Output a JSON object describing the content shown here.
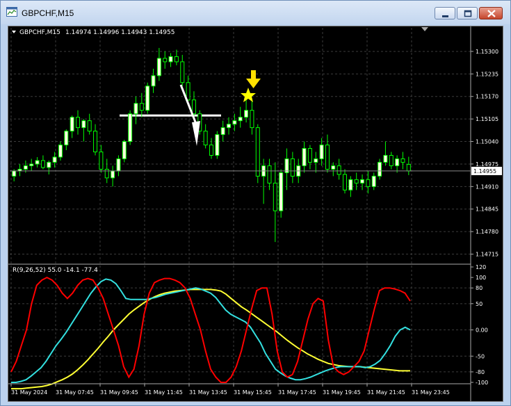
{
  "window": {
    "title": "GBPCHF,M15"
  },
  "chart_header": {
    "symbol": "GBPCHF,M15",
    "ohlc": "1.14974 1.14996 1.14943 1.14955"
  },
  "price_axis": {
    "labels": [
      "1.15300",
      "1.15235",
      "1.15170",
      "1.15105",
      "1.15040",
      "1.14975",
      "1.14910",
      "1.14845",
      "1.14780",
      "1.14715"
    ],
    "current_price": "1.14955"
  },
  "indicator": {
    "label": "R(9,26,52) 55.0 -14.1 -77.4",
    "axis_labels": [
      "120",
      "100",
      "80",
      "50",
      "0.00",
      "-50",
      "-80",
      "-100"
    ]
  },
  "time_axis": {
    "labels": [
      "31 May 2024",
      "31 May 07:45",
      "31 May 09:45",
      "31 May 11:45",
      "31 May 13:45",
      "31 May 15:45",
      "31 May 17:45",
      "31 May 19:45",
      "31 May 21:45",
      "31 May 23:45"
    ]
  },
  "colors": {
    "bull": "#ffffe0",
    "bear": "#00ff00",
    "red_line": "#ff0000",
    "cyan_line": "#33e0e0",
    "yellow_line": "#ffff33",
    "annotation": "#ffff00"
  },
  "chart_data": {
    "type": "line",
    "candles": [
      [
        1.1494,
        1.1496,
        1.14925,
        1.14955
      ],
      [
        1.14955,
        1.14975,
        1.1494,
        1.1496
      ],
      [
        1.1496,
        1.14985,
        1.1495,
        1.1497
      ],
      [
        1.1497,
        1.1499,
        1.14955,
        1.14975
      ],
      [
        1.14975,
        1.14995,
        1.14965,
        1.14985
      ],
      [
        1.14985,
        1.15,
        1.1496,
        1.14965
      ],
      [
        1.14965,
        1.14985,
        1.14945,
        1.1498
      ],
      [
        1.1498,
        1.1501,
        1.14965,
        1.14995
      ],
      [
        1.14995,
        1.1504,
        1.14985,
        1.1503
      ],
      [
        1.1503,
        1.15075,
        1.15015,
        1.1507
      ],
      [
        1.1507,
        1.15115,
        1.1505,
        1.1511
      ],
      [
        1.1511,
        1.1513,
        1.1506,
        1.1508
      ],
      [
        1.1508,
        1.15105,
        1.1504,
        1.151
      ],
      [
        1.151,
        1.1512,
        1.1506,
        1.1507
      ],
      [
        1.1507,
        1.1509,
        1.15,
        1.1501
      ],
      [
        1.1501,
        1.1503,
        1.1495,
        1.1496
      ],
      [
        1.1496,
        1.1499,
        1.1492,
        1.14935
      ],
      [
        1.14935,
        1.1497,
        1.1491,
        1.14955
      ],
      [
        1.14955,
        1.15,
        1.1494,
        1.1499
      ],
      [
        1.1499,
        1.15045,
        1.1498,
        1.1504
      ],
      [
        1.1504,
        1.1513,
        1.1503,
        1.1512
      ],
      [
        1.1512,
        1.1517,
        1.1509,
        1.1515
      ],
      [
        1.1515,
        1.1518,
        1.1511,
        1.1513
      ],
      [
        1.1513,
        1.1521,
        1.1512,
        1.152
      ],
      [
        1.152,
        1.1525,
        1.1518,
        1.1523
      ],
      [
        1.1523,
        1.1531,
        1.15215,
        1.1528
      ],
      [
        1.1528,
        1.153,
        1.1525,
        1.1527
      ],
      [
        1.1527,
        1.15295,
        1.15255,
        1.15285
      ],
      [
        1.15285,
        1.15305,
        1.1526,
        1.1527
      ],
      [
        1.1527,
        1.1529,
        1.152,
        1.1521
      ],
      [
        1.1521,
        1.1523,
        1.1515,
        1.1516
      ],
      [
        1.1516,
        1.15185,
        1.1511,
        1.1512
      ],
      [
        1.1512,
        1.1513,
        1.1506,
        1.1507
      ],
      [
        1.1507,
        1.1509,
        1.1502,
        1.1503
      ],
      [
        1.1503,
        1.1505,
        1.1499,
        1.15
      ],
      [
        1.15,
        1.1507,
        1.1499,
        1.1506
      ],
      [
        1.1506,
        1.151,
        1.1504,
        1.1508
      ],
      [
        1.1508,
        1.1511,
        1.1506,
        1.1509
      ],
      [
        1.1509,
        1.1512,
        1.1507,
        1.151
      ],
      [
        1.151,
        1.1514,
        1.1508,
        1.1511
      ],
      [
        1.1511,
        1.1517,
        1.15095,
        1.1513
      ],
      [
        1.1513,
        1.1516,
        1.1506,
        1.1508
      ],
      [
        1.1508,
        1.1509,
        1.1492,
        1.1494
      ],
      [
        1.1494,
        1.1499,
        1.1486,
        1.1497
      ],
      [
        1.1497,
        1.1499,
        1.149,
        1.1492
      ],
      [
        1.1492,
        1.1498,
        1.1475,
        1.1484
      ],
      [
        1.1484,
        1.1496,
        1.1482,
        1.1495
      ],
      [
        1.1495,
        1.1502,
        1.149,
        1.1499
      ],
      [
        1.1499,
        1.1501,
        1.1492,
        1.1494
      ],
      [
        1.1494,
        1.1499,
        1.1492,
        1.1497
      ],
      [
        1.1497,
        1.1504,
        1.1495,
        1.1502
      ],
      [
        1.1502,
        1.1503,
        1.1496,
        1.1498
      ],
      [
        1.1498,
        1.1501,
        1.1495,
        1.1499
      ],
      [
        1.1499,
        1.1505,
        1.1497,
        1.1503
      ],
      [
        1.1503,
        1.1506,
        1.1495,
        1.1496
      ],
      [
        1.1496,
        1.1498,
        1.1494,
        1.1497
      ],
      [
        1.1497,
        1.1499,
        1.1493,
        1.14945
      ],
      [
        1.14945,
        1.1496,
        1.1489,
        1.149
      ],
      [
        1.149,
        1.1494,
        1.1488,
        1.1493
      ],
      [
        1.1493,
        1.1495,
        1.149,
        1.1492
      ],
      [
        1.1492,
        1.14945,
        1.149,
        1.1493
      ],
      [
        1.1493,
        1.14955,
        1.1489,
        1.1491
      ],
      [
        1.1491,
        1.1495,
        1.149,
        1.1494
      ],
      [
        1.1494,
        1.1499,
        1.1493,
        1.1498
      ],
      [
        1.1498,
        1.1504,
        1.1497,
        1.15
      ],
      [
        1.15,
        1.1501,
        1.1496,
        1.1497
      ],
      [
        1.1497,
        1.15,
        1.1495,
        1.1499
      ],
      [
        1.1499,
        1.1501,
        1.1496,
        1.1498
      ],
      [
        1.14974,
        1.14996,
        1.14943,
        1.14955
      ]
    ],
    "price_range": [
      1.1469,
      1.1534
    ],
    "hline_price": 1.15115,
    "osc": {
      "range": [
        -100,
        120
      ],
      "red": [
        -80,
        -60,
        -30,
        0,
        50,
        85,
        95,
        100,
        95,
        85,
        70,
        60,
        70,
        85,
        95,
        98,
        95,
        80,
        60,
        30,
        0,
        -30,
        -70,
        -90,
        -75,
        -30,
        30,
        70,
        90,
        95,
        98,
        98,
        95,
        90,
        80,
        60,
        30,
        0,
        -40,
        -75,
        -90,
        -100,
        -100,
        -90,
        -70,
        -40,
        0,
        40,
        75,
        80,
        80,
        30,
        -40,
        -80,
        -90,
        -85,
        -60,
        -20,
        20,
        50,
        60,
        55,
        -20,
        -70,
        -80,
        -85,
        -80,
        -70,
        -60,
        -40,
        0,
        40,
        75,
        80,
        80,
        78,
        75,
        70,
        55
      ],
      "cyan": [
        -100,
        -100,
        -98,
        -95,
        -88,
        -80,
        -72,
        -60,
        -45,
        -30,
        -18,
        -5,
        10,
        25,
        40,
        55,
        70,
        82,
        92,
        97,
        95,
        88,
        75,
        60,
        58,
        58,
        58,
        58,
        60,
        62,
        65,
        68,
        70,
        72,
        74,
        76,
        78,
        80,
        78,
        74,
        70,
        62,
        50,
        38,
        30,
        25,
        20,
        15,
        5,
        -10,
        -25,
        -45,
        -60,
        -75,
        -82,
        -88,
        -92,
        -95,
        -95,
        -93,
        -90,
        -86,
        -82,
        -78,
        -75,
        -72,
        -70,
        -70,
        -70,
        -70,
        -70,
        -72,
        -70,
        -65,
        -58,
        -45,
        -30,
        -12,
        0,
        5,
        0
      ],
      "yellow": [
        -112,
        -112,
        -112,
        -111,
        -110,
        -109,
        -108,
        -106,
        -103,
        -99,
        -95,
        -90,
        -84,
        -76,
        -67,
        -57,
        -46,
        -35,
        -23,
        -12,
        0,
        10,
        20,
        30,
        38,
        45,
        52,
        58,
        63,
        67,
        70,
        72,
        74,
        75,
        76,
        77,
        77,
        77,
        77,
        77,
        76,
        74,
        68,
        60,
        52,
        44,
        38,
        31,
        24,
        17,
        10,
        3,
        -4,
        -12,
        -20,
        -27,
        -34,
        -40,
        -46,
        -51,
        -56,
        -60,
        -64,
        -66,
        -68,
        -69,
        -70,
        -70,
        -70,
        -71,
        -72,
        -73,
        -74,
        -75,
        -76,
        -77,
        -78,
        -78,
        -78
      ],
      "levels": [
        80,
        50,
        0,
        -50,
        -80
      ]
    }
  }
}
